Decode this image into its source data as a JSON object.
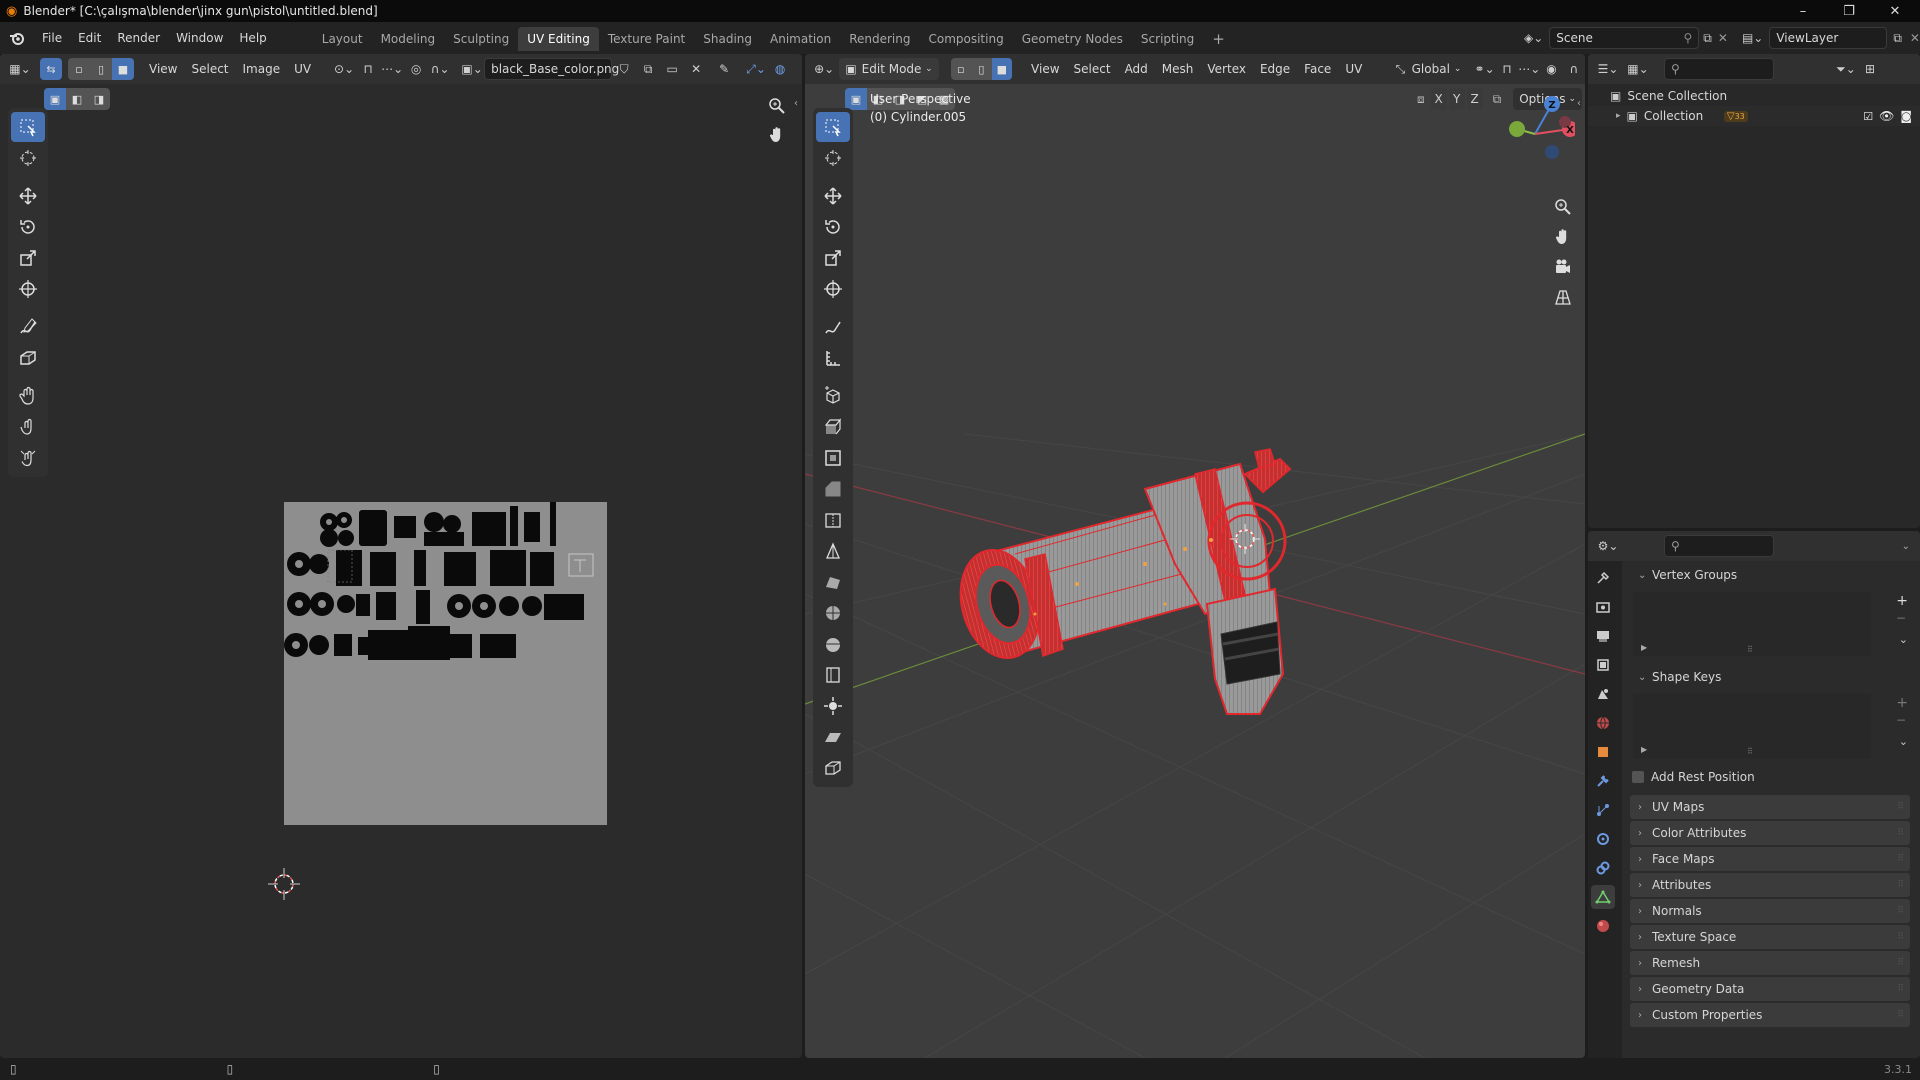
{
  "window": {
    "title": "Blender* [C:\\çalışma\\blender\\jinx gun\\pistol\\untitled.blend]",
    "controls": {
      "minimize": "–",
      "restore": "❐",
      "close": "✕"
    }
  },
  "topbar": {
    "menus": [
      "File",
      "Edit",
      "Render",
      "Window",
      "Help"
    ],
    "workspaces": [
      "Layout",
      "Modeling",
      "Sculpting",
      "UV Editing",
      "Texture Paint",
      "Shading",
      "Animation",
      "Rendering",
      "Compositing",
      "Geometry Nodes",
      "Scripting"
    ],
    "active_workspace": "UV Editing",
    "add_workspace": "+",
    "scene": "Scene",
    "view_layer": "ViewLayer"
  },
  "uv_editor": {
    "menus": [
      "View",
      "Select",
      "Image",
      "UV"
    ],
    "image_name": "black_Base_color.png"
  },
  "viewport": {
    "mode": "Edit Mode",
    "menus": [
      "View",
      "Select",
      "Add",
      "Mesh",
      "Vertex",
      "Edge",
      "Face",
      "UV"
    ],
    "orientation": "Global",
    "axes": [
      "X",
      "Y",
      "Z"
    ],
    "options_label": "Options",
    "perspective_label": "User Perspective",
    "object_label": "(0) Cylinder.005",
    "gizmo": {
      "x": "X",
      "y": "Y",
      "z": "Z"
    }
  },
  "outliner": {
    "scene_collection": "Scene Collection",
    "collection": "Collection",
    "collection_badge": "33"
  },
  "properties": {
    "panels": {
      "vertex_groups": "Vertex Groups",
      "shape_keys": "Shape Keys",
      "add_rest_position": "Add Rest Position",
      "uv_maps": "UV Maps",
      "color_attributes": "Color Attributes",
      "face_maps": "Face Maps",
      "attributes": "Attributes",
      "normals": "Normals",
      "texture_space": "Texture Space",
      "remesh": "Remesh",
      "geometry_data": "Geometry Data",
      "custom_properties": "Custom Properties"
    }
  },
  "statusbar": {
    "version": "3.3.1"
  },
  "colors": {
    "accent": "#4772b3",
    "mesh_wire": "#e0282d",
    "background": "#1d1d1d",
    "viewport_bg": "#3d3d3d",
    "axis_x": "#e05060",
    "axis_y": "#8cc046",
    "axis_z": "#4a82d8"
  }
}
